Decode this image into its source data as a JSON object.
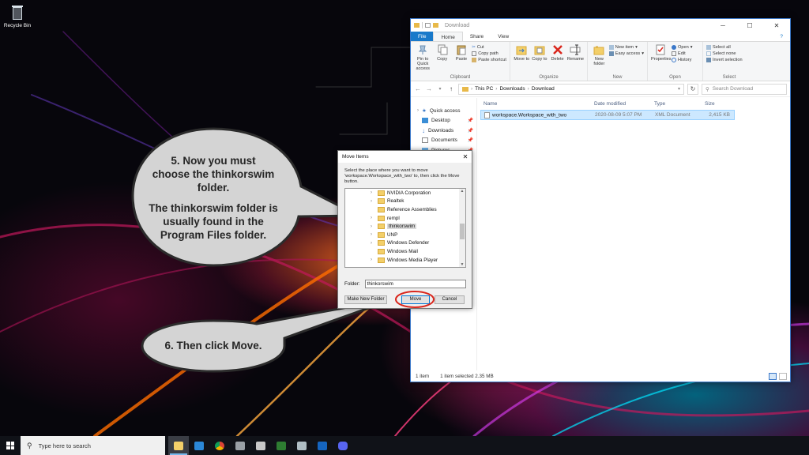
{
  "desktop": {
    "recycle_bin_label": "Recycle Bin"
  },
  "explorer": {
    "window_title": "Download",
    "ribbon_tabs": [
      "File",
      "Home",
      "Share",
      "View"
    ],
    "clipboard": {
      "pin_label": "Pin to Quick access",
      "copy_label": "Copy",
      "paste_label": "Paste",
      "cut_label": "Cut",
      "copy_path_label": "Copy path",
      "paste_shortcut_label": "Paste shortcut",
      "group_label": "Clipboard"
    },
    "organize": {
      "move_to_label": "Move to",
      "copy_to_label": "Copy to",
      "delete_label": "Delete",
      "rename_label": "Rename",
      "group_label": "Organize"
    },
    "new_group": {
      "new_folder_label": "New folder",
      "new_item_label": "New item",
      "easy_access_label": "Easy access",
      "group_label": "New"
    },
    "open_group": {
      "properties_label": "Properties",
      "open_label": "Open",
      "edit_label": "Edit",
      "history_label": "History",
      "group_label": "Open"
    },
    "select_group": {
      "select_all_label": "Select all",
      "select_none_label": "Select none",
      "invert_selection_label": "Invert selection",
      "group_label": "Select"
    },
    "breadcrumb": [
      "This PC",
      "Downloads",
      "Download"
    ],
    "search_placeholder": "Search Download",
    "nav": {
      "quick_access": "Quick access",
      "items": [
        "Desktop",
        "Downloads",
        "Documents",
        "Pictures"
      ]
    },
    "columns": [
      "Name",
      "Date modified",
      "Type",
      "Size"
    ],
    "files": [
      {
        "name": "workspace.Workspace_with_two",
        "date": "2020-08-09 5:07 PM",
        "type": "XML Document",
        "size": "2,415 KB"
      }
    ],
    "status": {
      "item_count": "1 item",
      "selection": "1 item selected  2.35 MB"
    }
  },
  "dialog": {
    "title": "Move Items",
    "close_glyph": "✕",
    "instruction": "Select the place where you want to move 'workspace.Workspace_with_two' to, then click the Move button.",
    "tree_items": [
      "NVIDIA Corporation",
      "Realtek",
      "Reference Assemblies",
      "rempl",
      "thinkorswim",
      "UNP",
      "Windows Defender",
      "Windows Mail",
      "Windows Media Player"
    ],
    "selected_item": "thinkorswim",
    "folder_label": "Folder:",
    "folder_value": "thinkorswim",
    "make_new_folder_label": "Make New Folder",
    "move_label": "Move",
    "cancel_label": "Cancel"
  },
  "callouts": {
    "step5": [
      "5. Now you must",
      "choose the thinkorswim",
      "folder.",
      "",
      "The thinkorswim folder is",
      "usually found in the",
      "Program Files folder."
    ],
    "step6": "6. Then click Move."
  },
  "taskbar": {
    "search_placeholder": "Type here to search",
    "apps": [
      "file-explorer-icon",
      "mail-icon",
      "chrome-icon",
      "store-icon",
      "printer-icon",
      "thinkorswim-icon",
      "paint-icon",
      "calculator-icon",
      "discord-icon"
    ]
  },
  "colors": {
    "accent": "#1979ca",
    "selection": "#cce8ff",
    "highlight_ring": "#d9261c",
    "callout_fill": "#d4d4d4"
  }
}
